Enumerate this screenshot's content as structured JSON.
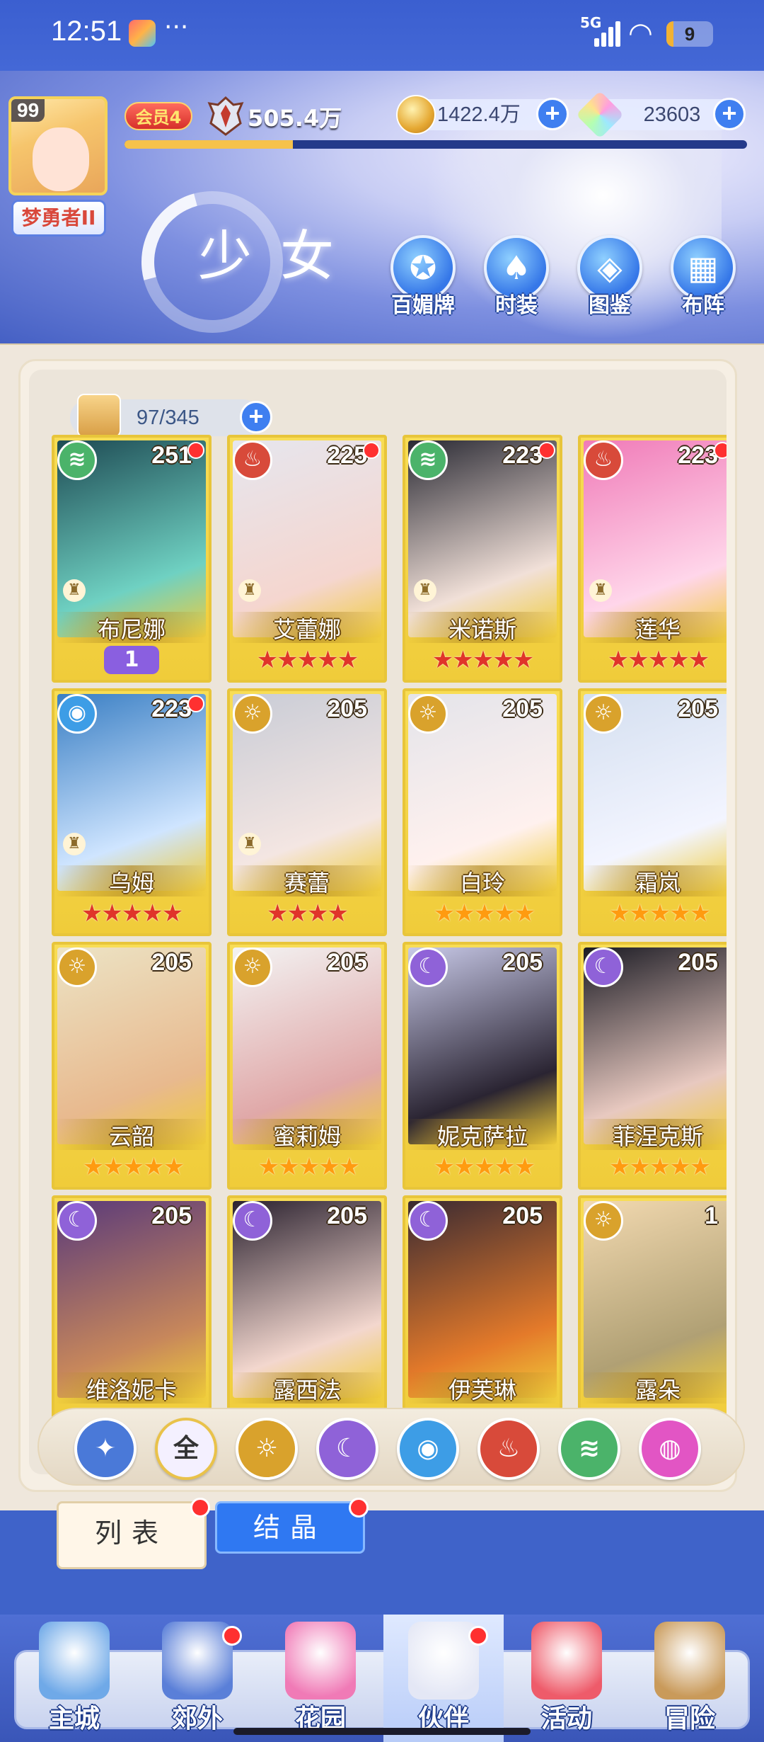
{
  "status_bar": {
    "time": "12:51",
    "network": "5G",
    "battery": "9",
    "battery_fraction": 0.09
  },
  "player": {
    "level": "99",
    "name": "梦勇者II",
    "vip": "会员4",
    "power": "505.4万",
    "exp_fraction": 0.27
  },
  "currencies": {
    "gold": "1422.4万",
    "gems": "23603"
  },
  "banner": {
    "title": "少女",
    "buttons": [
      {
        "label": "百媚牌",
        "icon": "card-icon"
      },
      {
        "label": "时装",
        "icon": "outfit-icon"
      },
      {
        "label": "图鉴",
        "icon": "book-icon"
      },
      {
        "label": "布阵",
        "icon": "grid-icon"
      }
    ]
  },
  "capacity": {
    "text": "97/345"
  },
  "cards": [
    {
      "name": "布尼娜",
      "level": "251",
      "element": "wind",
      "dot": true,
      "chess": true,
      "stars": 0,
      "star_color": "",
      "awaken": "1"
    },
    {
      "name": "艾蕾娜",
      "level": "225",
      "element": "fire",
      "dot": true,
      "chess": true,
      "stars": 5,
      "star_color": "red"
    },
    {
      "name": "米诺斯",
      "level": "223",
      "element": "wind",
      "dot": true,
      "chess": true,
      "stars": 5,
      "star_color": "red"
    },
    {
      "name": "莲华",
      "level": "223",
      "element": "fire",
      "dot": true,
      "chess": true,
      "stars": 5,
      "star_color": "red"
    },
    {
      "name": "乌姆",
      "level": "223",
      "element": "water",
      "dot": true,
      "chess": true,
      "stars": 5,
      "star_color": "red"
    },
    {
      "name": "赛蕾",
      "level": "205",
      "element": "light",
      "dot": false,
      "chess": true,
      "stars": 4,
      "star_color": "red"
    },
    {
      "name": "白玲",
      "level": "205",
      "element": "light",
      "dot": false,
      "chess": false,
      "stars": 5,
      "star_color": "gold"
    },
    {
      "name": "霜岚",
      "level": "205",
      "element": "light",
      "dot": false,
      "chess": false,
      "stars": 5,
      "star_color": "gold"
    },
    {
      "name": "云韶",
      "level": "205",
      "element": "light",
      "dot": false,
      "chess": false,
      "stars": 5,
      "star_color": "gold"
    },
    {
      "name": "蜜莉姆",
      "level": "205",
      "element": "light",
      "dot": false,
      "chess": false,
      "stars": 5,
      "star_color": "gold"
    },
    {
      "name": "妮克萨拉",
      "level": "205",
      "element": "dark",
      "dot": false,
      "chess": false,
      "stars": 5,
      "star_color": "gold"
    },
    {
      "name": "菲涅克斯",
      "level": "205",
      "element": "dark",
      "dot": false,
      "chess": false,
      "stars": 5,
      "star_color": "gold"
    },
    {
      "name": "维洛妮卡",
      "level": "205",
      "element": "dark",
      "dot": false,
      "chess": false,
      "stars": 0,
      "star_color": ""
    },
    {
      "name": "露西法",
      "level": "205",
      "element": "dark",
      "dot": false,
      "chess": false,
      "stars": 0,
      "star_color": ""
    },
    {
      "name": "伊芙琳",
      "level": "205",
      "element": "dark",
      "dot": false,
      "chess": false,
      "stars": 0,
      "star_color": ""
    },
    {
      "name": "露朵",
      "level": "1",
      "element": "light",
      "dot": false,
      "chess": false,
      "stars": 0,
      "star_color": ""
    }
  ],
  "element_colors": {
    "wind": "#4bb36a",
    "fire": "#d84a3a",
    "water": "#3d9de6",
    "light": "#d9a22c",
    "dark": "#8f62d8",
    "all": "#f4f0ff",
    "pink": "#e255c4"
  },
  "filters": [
    {
      "id": "star",
      "label": "",
      "icon": "star-filter-icon",
      "color": "#4a79d8"
    },
    {
      "id": "all",
      "label": "全",
      "icon": "all-filter-icon",
      "color": "#f4f0ff"
    },
    {
      "id": "light",
      "label": "",
      "icon": "sun-icon",
      "color": "#d9a22c"
    },
    {
      "id": "dark",
      "label": "",
      "icon": "moon-icon",
      "color": "#8f62d8"
    },
    {
      "id": "water",
      "label": "",
      "icon": "drop-icon",
      "color": "#3d9de6"
    },
    {
      "id": "fire",
      "label": "",
      "icon": "fire-icon",
      "color": "#d84a3a"
    },
    {
      "id": "wind",
      "label": "",
      "icon": "wind-icon",
      "color": "#4bb36a"
    },
    {
      "id": "void",
      "label": "",
      "icon": "orb-icon",
      "color": "#e255c4"
    }
  ],
  "tabs": {
    "list": "列表",
    "crystal": "结晶"
  },
  "nav": [
    {
      "label": "主城",
      "dot": false
    },
    {
      "label": "郊外",
      "dot": true
    },
    {
      "label": "花园",
      "dot": false
    },
    {
      "label": "伙伴",
      "dot": true,
      "active": true
    },
    {
      "label": "活动",
      "dot": false
    },
    {
      "label": "冒险",
      "dot": false
    }
  ]
}
